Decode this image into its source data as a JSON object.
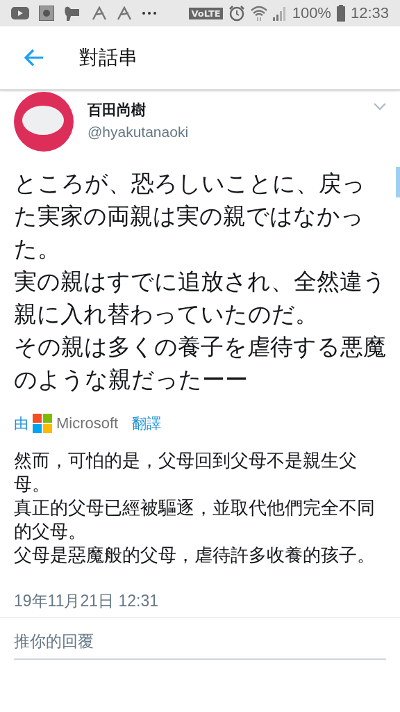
{
  "status_bar": {
    "network": "VoLTE",
    "battery": "100%",
    "time": "12:33"
  },
  "header": {
    "title": "對話串"
  },
  "tweet": {
    "name": "百田尚樹",
    "handle": "@hyakutanaoki",
    "paragraphs": [
      "ところが、恐ろしいことに、戻った実家の両親は実の親ではなかった。",
      "実の親はすでに追放され、全然違う親に入れ替わっていたのだ。",
      "その親は多くの養子を虐待する悪魔のような親だったーー"
    ],
    "translation_by": {
      "prefix": "由",
      "brand": "Microsoft",
      "action": "翻譯"
    },
    "translation": [
      "然而，可怕的是，父母回到父母不是親生父母。",
      "真正的父母已經被驅逐，並取代他們完全不同的父母。",
      "父母是惡魔般的父母，虐待許多收養的孩子。"
    ],
    "timestamp": "19年11月21日 12:31"
  },
  "reply": {
    "placeholder": "推你的回覆"
  }
}
